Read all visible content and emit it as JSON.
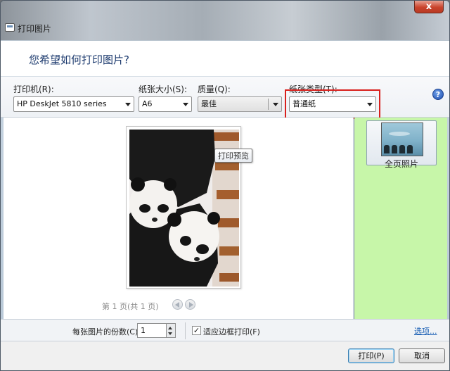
{
  "window": {
    "title": "打印图片",
    "close_label": "x"
  },
  "header": {
    "question": "您希望如何打印图片?"
  },
  "options": {
    "printer_label": "打印机(R):",
    "printer_value": "HP DeskJet 5810 series",
    "paper_size_label": "纸张大小(S):",
    "paper_size_value": "A6",
    "quality_label": "质量(Q):",
    "quality_value": "最佳",
    "paper_type_label": "纸张类型(T):",
    "paper_type_value": "普通纸",
    "help_label": "?"
  },
  "preview": {
    "tooltip": "打印预览",
    "page_indicator": "第 1 页(共 1 页)"
  },
  "layout": {
    "item_label": "全页照片"
  },
  "copies": {
    "label": "每张图片的份数(C):",
    "value": "1",
    "fit_label": "适应边框打印(F)",
    "fit_checked_mark": "✓",
    "options_link": "选项..."
  },
  "footer": {
    "print_label": "打印(P)",
    "cancel_label": "取消"
  },
  "colors": {
    "highlight": "#d8201c",
    "layout_panel": "#c7f6a9",
    "link": "#1a5fb4"
  }
}
